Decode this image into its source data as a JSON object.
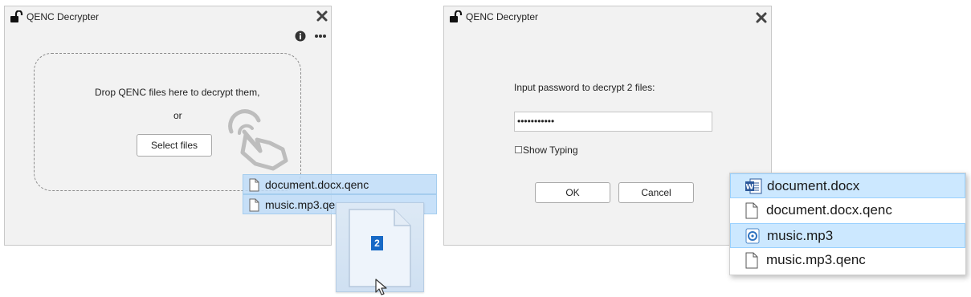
{
  "left_window": {
    "title": "QENC Decrypter",
    "drop_text": "Drop QENC files here to decrypt them,",
    "or_text": "or",
    "select_button": "Select files",
    "icons": [
      "unlock-icon",
      "close-icon",
      "info-icon",
      "more-icon",
      "tap-hand-icon"
    ]
  },
  "drag_overlay": {
    "files": [
      "document.docx.qenc",
      "music.mp3.qenc"
    ],
    "count_badge": "2"
  },
  "right_window": {
    "title": "QENC Decrypter",
    "prompt": "Input password to decrypt 2 files:",
    "password_value": "•••••••••••",
    "show_typing_label": "Show Typing",
    "show_typing_checked": false,
    "ok_button": "OK",
    "cancel_button": "Cancel"
  },
  "explorer": {
    "files": [
      {
        "name": "document.docx",
        "icon": "word-doc-icon",
        "selected": true
      },
      {
        "name": "document.docx.qenc",
        "icon": "blank-file-icon",
        "selected": false
      },
      {
        "name": "music.mp3",
        "icon": "media-audio-icon",
        "selected": true
      },
      {
        "name": "music.mp3.qenc",
        "icon": "blank-file-icon",
        "selected": false
      }
    ]
  },
  "colors": {
    "window_bg": "#f2f2f2",
    "selection_bg": "#cce8ff",
    "badge_bg": "#1769c6"
  }
}
